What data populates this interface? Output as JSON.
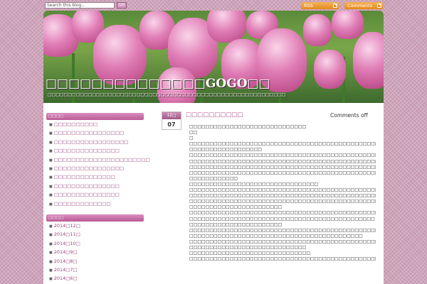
{
  "topbar": {
    "search_placeholder": "Search this blog...",
    "search_button": "GO",
    "rss_label": "RSS",
    "comments_label": "Comments"
  },
  "header": {
    "title": "□□□□□□□□□□□□□□GOGO□□",
    "description": "□□□□□□□□□□□□□□□□□□□□□□□□□□□□□□□□□□□□□□□□□□□□□□□□□□□□□□□□□□□"
  },
  "sidebar": {
    "categories_title": "□□□□",
    "categories": [
      "□□□□□□□□□□",
      "□□□□□□□□□□□□□□□□",
      "□□□□□□□□□□□□□□□□□",
      "□□□□□□□□□□□□□□□",
      "□□□□□□□□□□□□□□□□□□□□□□",
      "□□□□□□□□□□□□□□□□",
      "□□□□□□□□□□□□□□",
      "□□□□□□□□□□□□□□□",
      "□□□□□□□□□□□□□□□",
      "□□□□□□□□□□□□□"
    ],
    "archives_title": "□□□□",
    "archives": [
      "2014□12□",
      "2014□11□",
      "2014□10□",
      "2014□9□",
      "2014□8□",
      "2014□7□",
      "2014□6□"
    ]
  },
  "post": {
    "date_month": "12□",
    "date_day": "07",
    "title": "□□□□□□□□□□",
    "comments": "Comments off",
    "lines": [
      "□□□□□□□□□□□□□□□□□□□□□□□□□□□□□",
      "□□",
      "□",
      "□□□□□□□□□□□□□□□□□□□□□□□□□□□□□□□□□□□□□□□□□□□□□□□□□□□",
      "□□□□□□□□□□□□□□□□□□",
      "□□□□□□□□□□□□□□□□□□□□□□□□□□□□□□□□□□□□□□□□□□□□□□□□□□□□□□□□□□□",
      "□□□□□□□□□□□□□□□□□□□□□□□□□□□□□□□□□□□□□□□□□□□□□□□□□□□□□□□□",
      "□□□□□□□□□□□□□□□□□□□□□□□□□□□□□□□□□□□□□□□□□□□□□□□□□",
      "□□□□□□□□□□□□□□□□□□□□□□□□□□□□□□□□□□□□□□□□□□□□□□□□□□□",
      "□□□□□□□□□□□□",
      "□□□□□□□□□□□□□□□□□□□□□□□□□□□□□□□□",
      "□□□□□□□□□□□□□□□□□□□□□□□□□□□□□□□□□□□□□□□□□□□□□□□□□□□□□□□□□□□□",
      "□□□□□□□□□□□□□□□□□□□□□□□□□□□□□□□□□□□□□□□□□□□□□□□□□□□□□□□□□□□",
      "□□□□□□□□□□□□□□□□□□□□□□□□□□□□□□□□□□□□□□□□□□□□□□□□□□□□□□□□□□□□",
      "□□□□□□□□□□□□□□□□□□□□□□□",
      "□□□□□□□□□□□□□□□□□□□□□□□□□□□□□□□□□□□□□□□□□□□□□□□□□□□□□□□□□□□□",
      "□□□□□□□□□□□□□□□□□□□□□□□□□□□□□□□□□□□□□□□□□□□□□□",
      "□□□□□□□□□□□□□□□□□□□□□□□",
      "□□□□□□□□□□□□□□□□□□□□□□□□□□□□□□□□□□□□□□□□□□□□□□□□□□□□□□□□□□□",
      "□□□□□□□□□□□□□□□□□□□□□□□□□□□□□□□□□□□□□□□□□□□",
      "□□□□□□□□□□□□□□□□□□□□□□□□□□□□□□□□□□□□□□□□□□□□□□□□□□□□□□□□□□□□",
      "□□□□□□□□□□□□□□□□□□□□□□□□□□□□□",
      "□□□□□□□□□□□□□□□□□□□□□□□□□□□□□□",
      "□□□□□□□□□□□□□□□□□□□□□□□□□□□□□□□□□□□□□□□□□□□□□□□□□□□□□□□□□□□□"
    ]
  },
  "colors": {
    "background": "#c79bb2",
    "accent": "#b44f8d",
    "widget_header": "#c474a8"
  }
}
